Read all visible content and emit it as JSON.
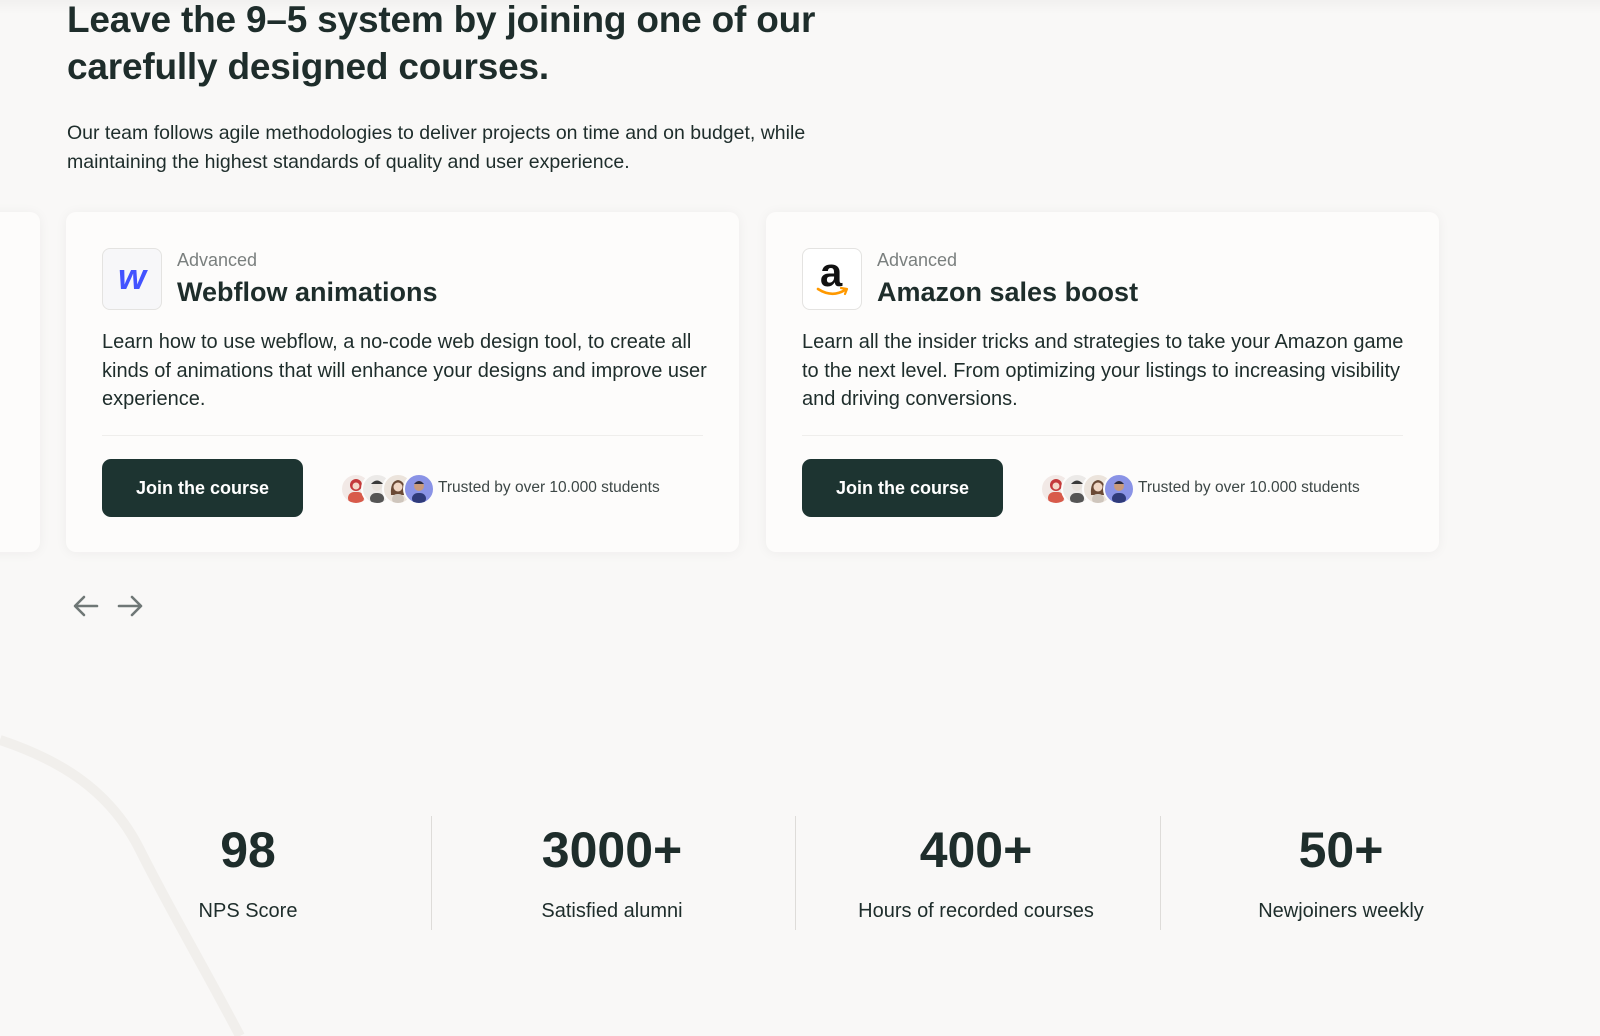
{
  "hero": {
    "headline": "Leave the 9–5 system by joining one of our carefully designed courses.",
    "intro": "Our team follows agile methodologies to deliver projects on time and on budget, while maintaining the highest standards of quality and user experience."
  },
  "courses": [
    {
      "level": "Advanced",
      "title": "Webflow animations",
      "description": "Learn how to use webflow, a no-code web design tool, to create all kinds of animations that will enhance your designs and improve user experience.",
      "cta": "Join the course",
      "trusted": "Trusted by over 10.000 students",
      "logo_icon": "webflow-logo-icon",
      "logo_letter": "w"
    },
    {
      "level": "Advanced",
      "title": "Amazon sales boost",
      "description": "Learn all the insider tricks and strategies to take your Amazon game to the next level. From optimizing your listings to increasing visibility and driving conversions.",
      "cta": "Join the course",
      "trusted": "Trusted by over 10.000 students",
      "logo_icon": "amazon-logo-icon",
      "logo_letter": "a"
    }
  ],
  "carousel": {
    "prev_icon": "arrow-left-icon",
    "next_icon": "arrow-right-icon"
  },
  "stats": [
    {
      "value": "98",
      "label": "NPS Score"
    },
    {
      "value": "3000+",
      "label": "Satisfied alumni"
    },
    {
      "value": "400+",
      "label": "Hours of recorded courses"
    },
    {
      "value": "50+",
      "label": "Newjoiners weekly"
    }
  ],
  "colors": {
    "background": "#f9f8f7",
    "text_dark": "#1e2d2b",
    "button": "#1d3431",
    "webflow_blue": "#4353ff",
    "amazon_orange": "#ff9900"
  }
}
